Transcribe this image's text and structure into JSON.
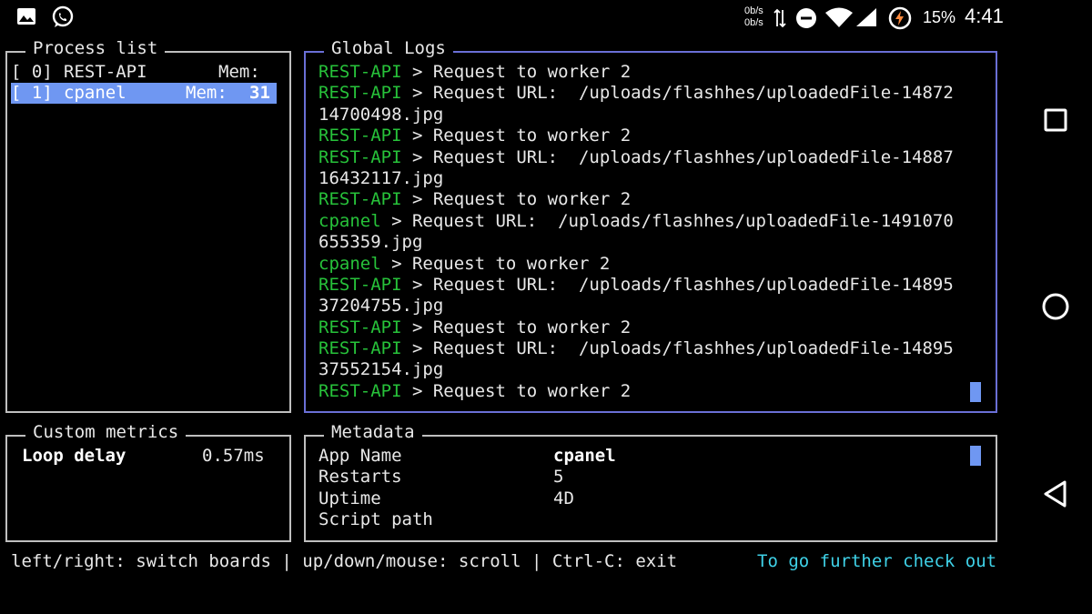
{
  "status_bar": {
    "net_up": "0b/s",
    "net_down": "0b/s",
    "battery_percent": "15%",
    "time": "4:41",
    "icons": [
      "gallery-icon",
      "whatsapp-icon",
      "data-arrows-icon",
      "do-not-disturb-icon",
      "wifi-icon",
      "cell-signal-icon",
      "battery-charging-icon"
    ]
  },
  "process_list": {
    "title": "Process list",
    "rows": [
      {
        "id": "[ 0]",
        "name": "REST-API",
        "mem_label": "Mem:",
        "mem_value": "",
        "selected": false
      },
      {
        "id": "[ 1]",
        "name": "cpanel",
        "mem_label": "Mem:",
        "mem_value": "31",
        "selected": true
      }
    ]
  },
  "global_logs": {
    "title": "Global Logs",
    "lines": [
      {
        "src": "REST-API",
        "msg": " > Request to worker 2"
      },
      {
        "src": "REST-API",
        "msg": " > Request URL:  /uploads/flashhes/uploadedFile-14872"
      },
      {
        "src": "",
        "msg": "14700498.jpg"
      },
      {
        "src": "REST-API",
        "msg": " > Request to worker 2"
      },
      {
        "src": "REST-API",
        "msg": " > Request URL:  /uploads/flashhes/uploadedFile-14887"
      },
      {
        "src": "",
        "msg": "16432117.jpg"
      },
      {
        "src": "REST-API",
        "msg": " > Request to worker 2"
      },
      {
        "src": "cpanel",
        "msg": " > Request URL:  /uploads/flashhes/uploadedFile-1491070"
      },
      {
        "src": "",
        "msg": "655359.jpg"
      },
      {
        "src": "cpanel",
        "msg": " > Request to worker 2"
      },
      {
        "src": "REST-API",
        "msg": " > Request URL:  /uploads/flashhes/uploadedFile-14895"
      },
      {
        "src": "",
        "msg": "37204755.jpg"
      },
      {
        "src": "REST-API",
        "msg": " > Request to worker 2"
      },
      {
        "src": "REST-API",
        "msg": " > Request URL:  /uploads/flashhes/uploadedFile-14895"
      },
      {
        "src": "",
        "msg": "37552154.jpg"
      },
      {
        "src": "REST-API",
        "msg": " > Request to worker 2"
      }
    ]
  },
  "custom_metrics": {
    "title": "Custom metrics",
    "label": "Loop delay",
    "value": "0.57ms"
  },
  "metadata": {
    "title": "Metadata",
    "rows": [
      {
        "key": "App Name",
        "value": "cpanel",
        "bold": true
      },
      {
        "key": "Restarts",
        "value": "5",
        "bold": false
      },
      {
        "key": "Uptime",
        "value": "4D",
        "bold": false
      },
      {
        "key": "Script path",
        "value": "",
        "bold": false
      }
    ]
  },
  "footer": {
    "help": "left/right: switch boards | up/down/mouse: scroll | Ctrl-C: exit",
    "link": "To go further check out"
  },
  "colors": {
    "accent_green": "#27c23a",
    "selection_blue": "#6f97f2",
    "logs_border": "#6a6fd6",
    "link_cyan": "#3fd2e8"
  }
}
